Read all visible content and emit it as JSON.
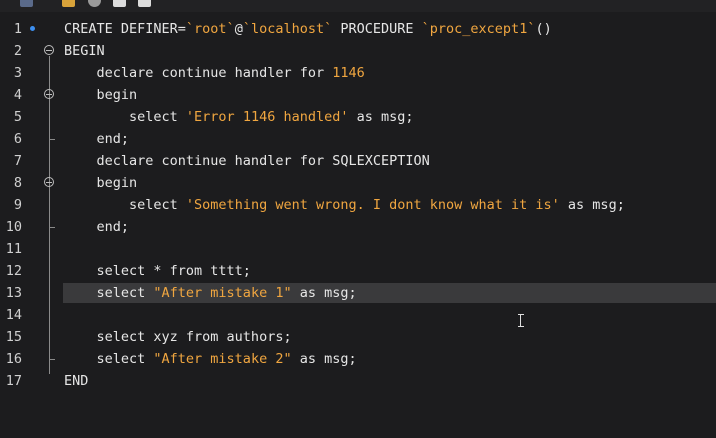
{
  "colors": {
    "background": "#1c1c1e",
    "text": "#e6e6e6",
    "string": "#f0a640",
    "highlight": "#3a3a3c",
    "marker": "#3d8ff0"
  },
  "toolbar": {
    "icons": [
      "save-icon",
      "tag-icon",
      "search-icon",
      "table-icon",
      "export-icon"
    ]
  },
  "editor": {
    "highlighted_line": 13,
    "lines": [
      {
        "n": "1",
        "parts": [
          [
            "CREATE DEFINER=",
            "t"
          ],
          [
            "`root`",
            "s"
          ],
          [
            "@",
            "t"
          ],
          [
            "`localhost`",
            "s"
          ],
          [
            " PROCEDURE ",
            "t"
          ],
          [
            "`proc_except1`",
            "s"
          ],
          [
            "()",
            "t"
          ]
        ]
      },
      {
        "n": "2",
        "parts": [
          [
            "BEGIN",
            "t"
          ]
        ]
      },
      {
        "n": "3",
        "parts": [
          [
            "    declare continue handler for ",
            "t"
          ],
          [
            "1146",
            "s"
          ]
        ]
      },
      {
        "n": "4",
        "parts": [
          [
            "    begin",
            "t"
          ]
        ]
      },
      {
        "n": "5",
        "parts": [
          [
            "        select ",
            "t"
          ],
          [
            "'Error 1146 handled'",
            "s"
          ],
          [
            " as msg;",
            "t"
          ]
        ]
      },
      {
        "n": "6",
        "parts": [
          [
            "    end;",
            "t"
          ]
        ]
      },
      {
        "n": "7",
        "parts": [
          [
            "    declare continue handler for SQLEXCEPTION",
            "t"
          ]
        ]
      },
      {
        "n": "8",
        "parts": [
          [
            "    begin",
            "t"
          ]
        ]
      },
      {
        "n": "9",
        "parts": [
          [
            "        select ",
            "t"
          ],
          [
            "'Something went wrong. I dont know what it is'",
            "s"
          ],
          [
            " as msg;",
            "t"
          ]
        ]
      },
      {
        "n": "10",
        "parts": [
          [
            "    end;",
            "t"
          ]
        ]
      },
      {
        "n": "11",
        "parts": []
      },
      {
        "n": "12",
        "parts": [
          [
            "    select * from tttt;",
            "t"
          ]
        ]
      },
      {
        "n": "13",
        "parts": [
          [
            "    select ",
            "t"
          ],
          [
            "\"After mistake 1\"",
            "s"
          ],
          [
            " as msg;",
            "t"
          ]
        ]
      },
      {
        "n": "14",
        "parts": []
      },
      {
        "n": "15",
        "parts": [
          [
            "    select xyz from authors;",
            "t"
          ]
        ]
      },
      {
        "n": "16",
        "parts": [
          [
            "    select ",
            "t"
          ],
          [
            "\"After mistake 2\"",
            "s"
          ],
          [
            " as msg;",
            "t"
          ]
        ]
      },
      {
        "n": "17",
        "parts": [
          [
            "END",
            "t"
          ]
        ]
      }
    ]
  }
}
